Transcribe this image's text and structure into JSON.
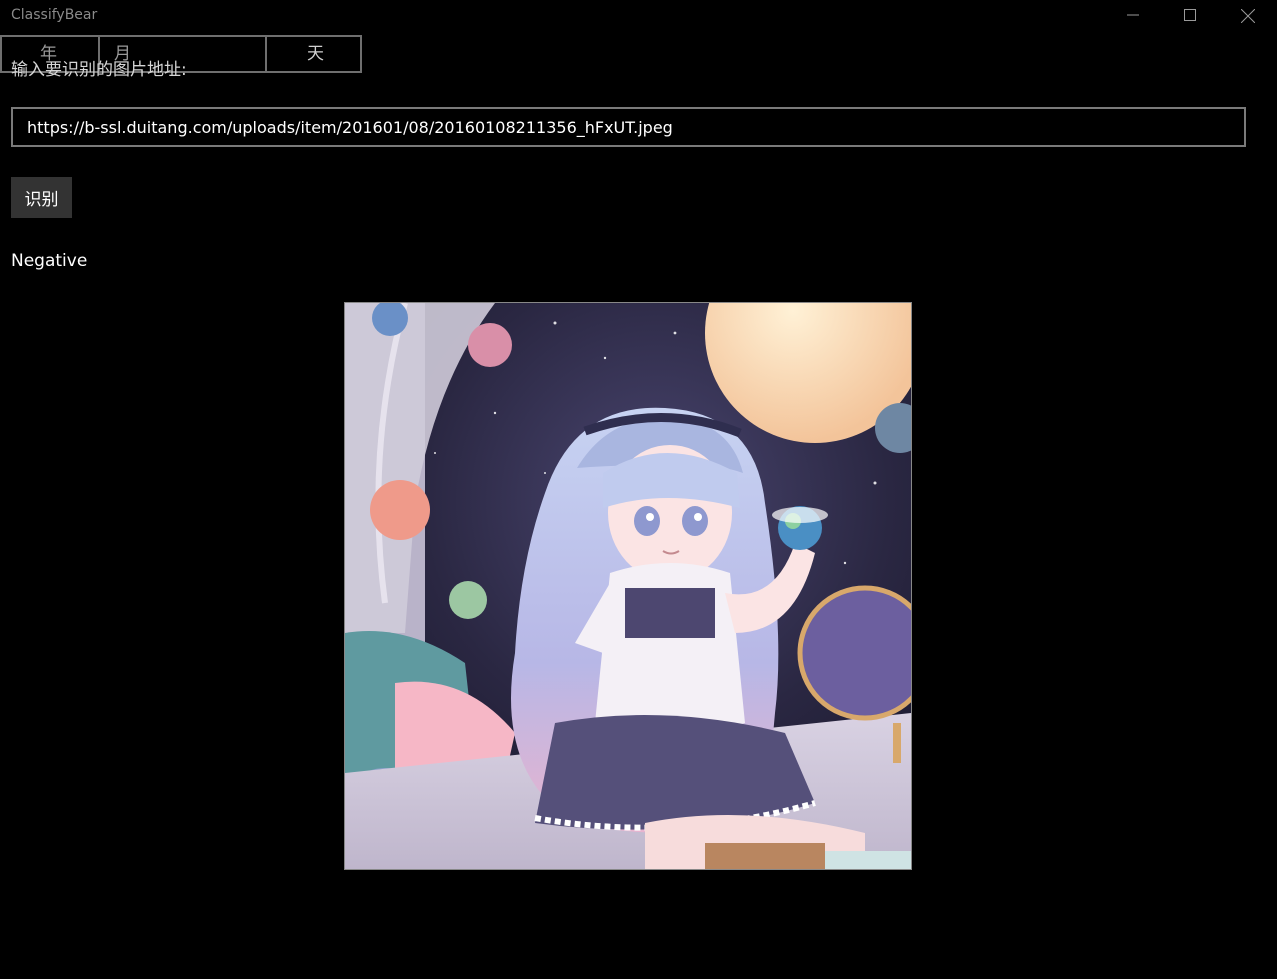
{
  "window": {
    "title": "ClassifyBear",
    "controls": [
      "minimize-icon",
      "maximize-icon",
      "close-icon"
    ]
  },
  "date_picker": {
    "year": "年",
    "month": "月",
    "day": "天"
  },
  "form": {
    "prompt": "输入要识别的图片地址:",
    "url_value": "https://b-ssl.duitang.com/uploads/item/201601/08/20160108211356_hFxUT.jpeg",
    "button_label": "识别"
  },
  "result": {
    "text": "Negative"
  },
  "colors": {
    "background": "#000000",
    "button": "#333333",
    "border": "#7a7a7a",
    "title_text": "#8a8a8a"
  }
}
